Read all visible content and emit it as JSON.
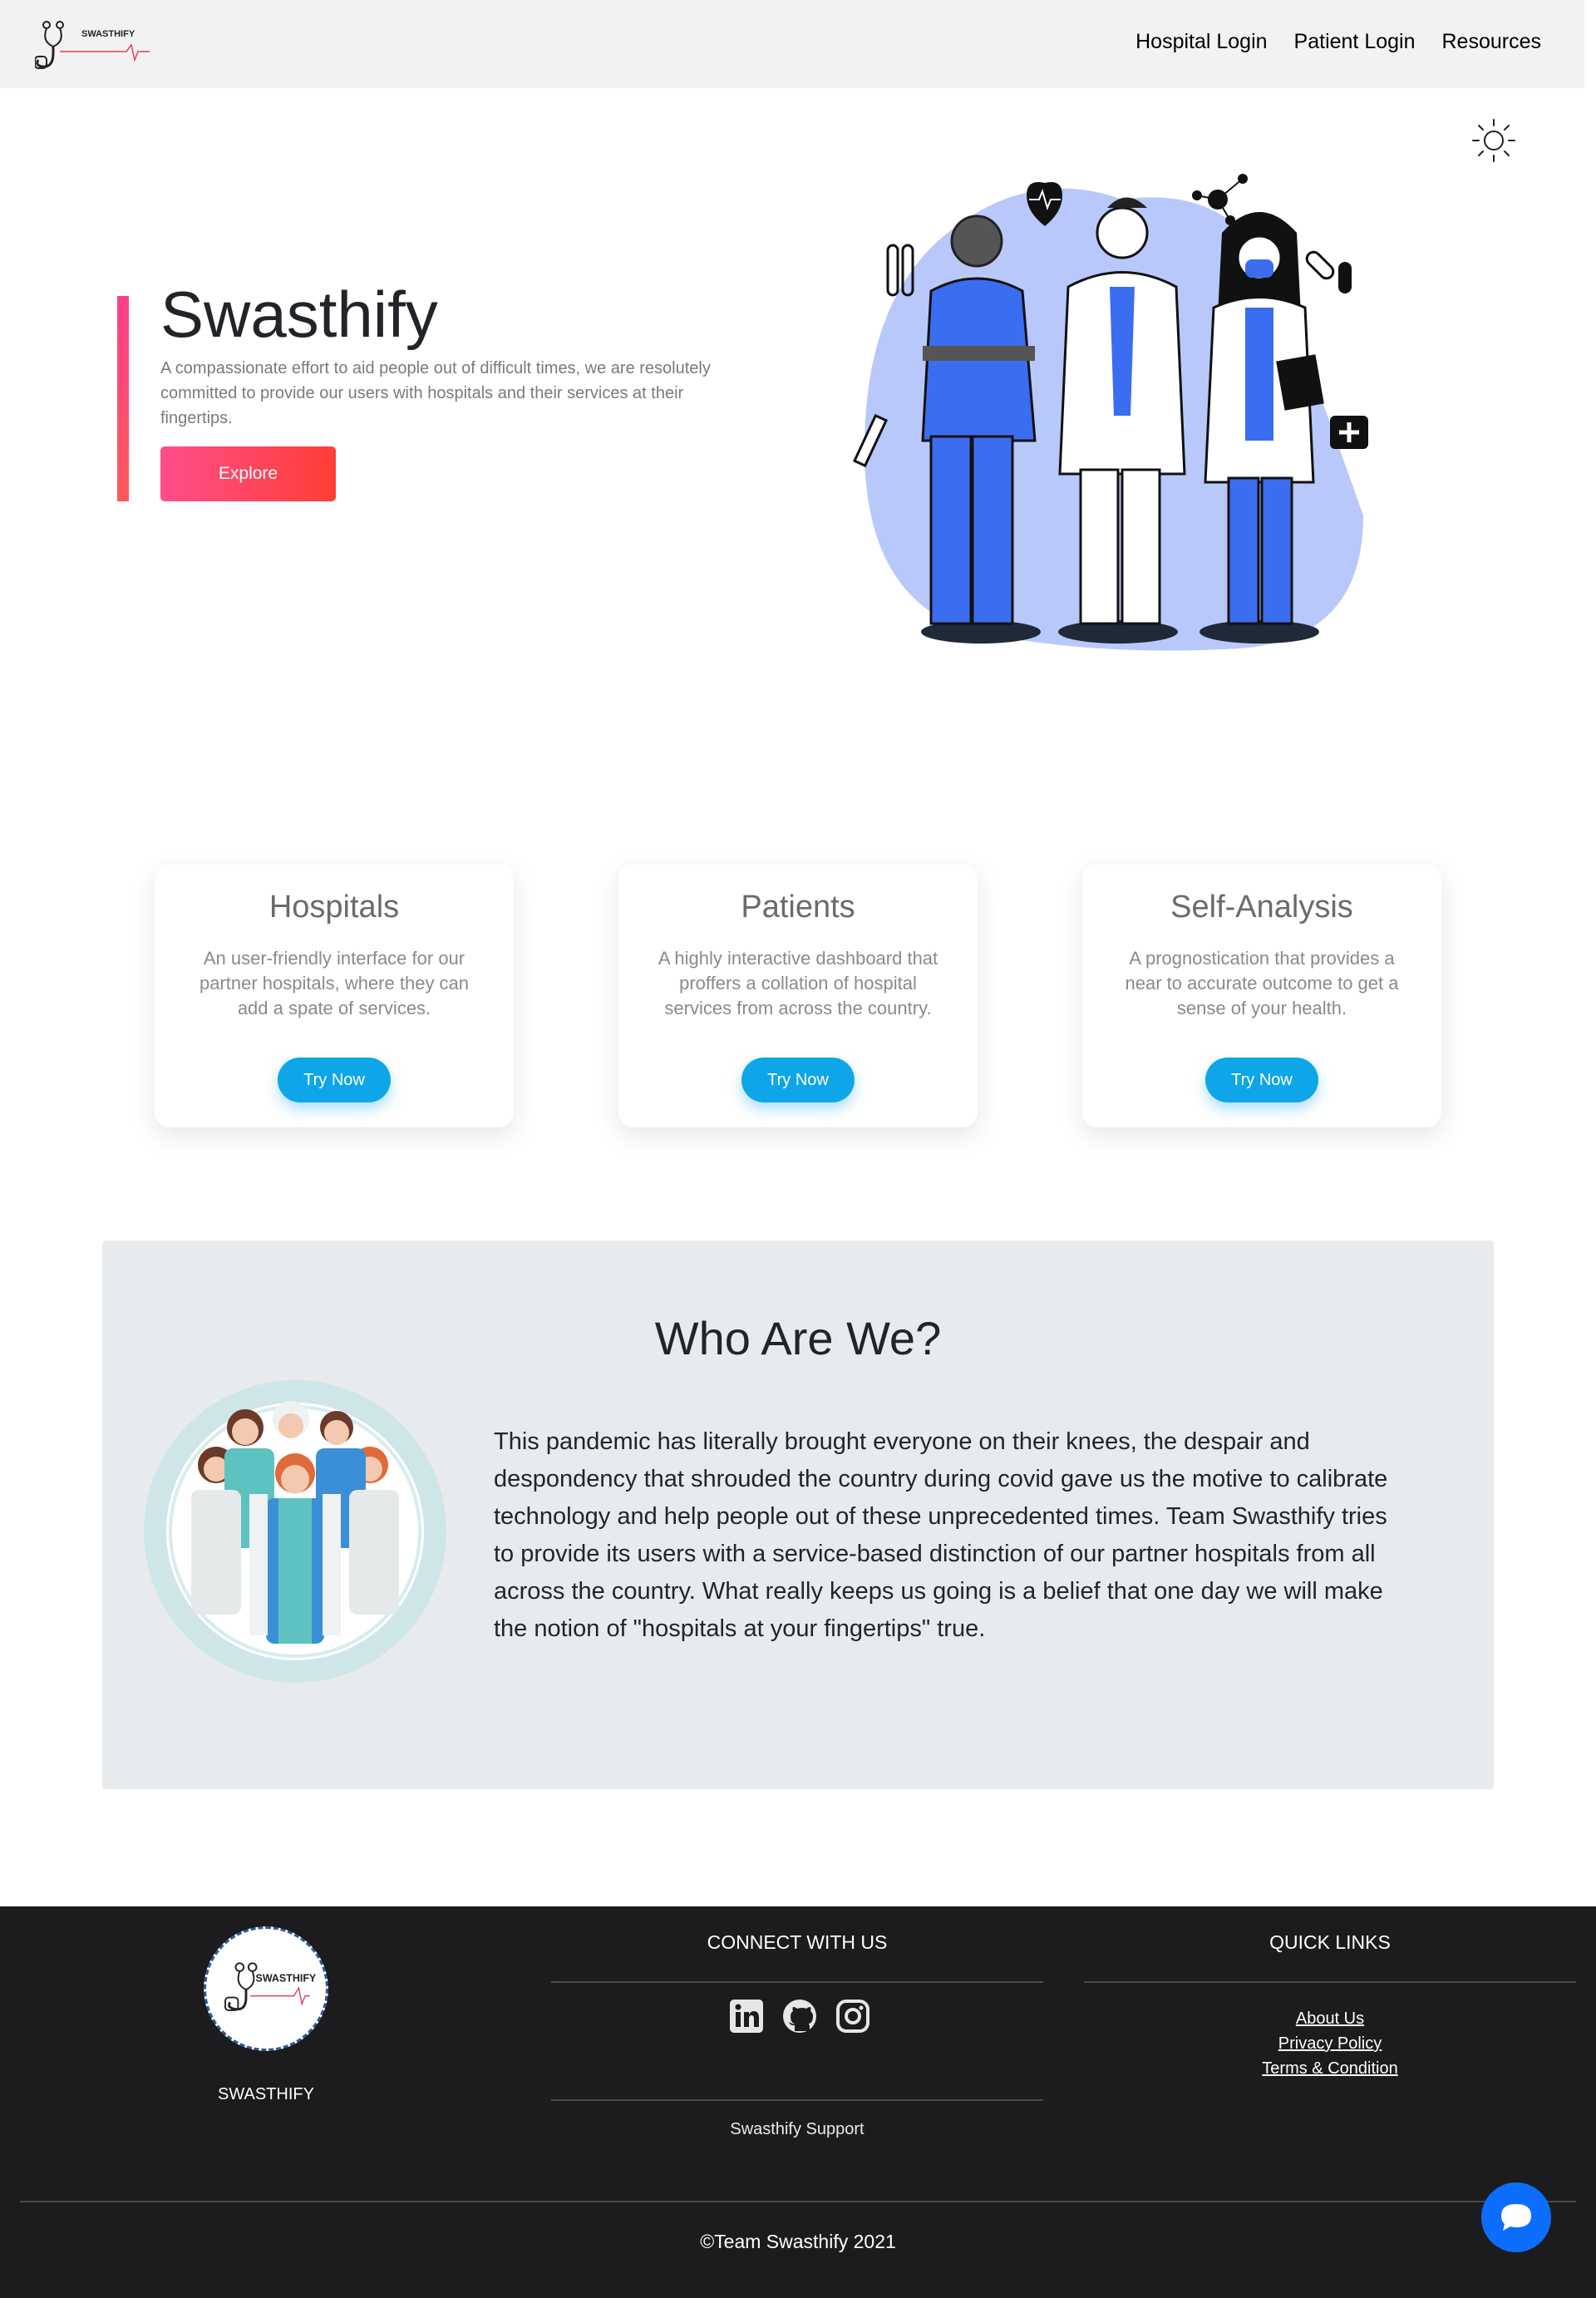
{
  "nav": {
    "logo_text": "SWASTHIFY",
    "links": [
      "Hospital Login",
      "Patient Login",
      "Resources"
    ]
  },
  "hero": {
    "title": "Swasthify",
    "description": "A compassionate effort to aid people out of difficult times, we are resolutely committed to provide our users with hospitals and their services at their fingertips.",
    "button": "Explore"
  },
  "cards": [
    {
      "title": "Hospitals",
      "text": "An user-friendly interface for our partner hospitals, where they can add a spate of services.",
      "button": "Try Now"
    },
    {
      "title": "Patients",
      "text": "A highly interactive dashboard that proffers a collation of hospital services from across the country.",
      "button": "Try Now"
    },
    {
      "title": "Self-Analysis",
      "text": "A prognostication that provides a near to accurate outcome to get a sense of your health.",
      "button": "Try Now"
    }
  ],
  "who": {
    "title": "Who Are We?",
    "text": "This pandemic has literally brought everyone on their knees, the despair and despondency that shrouded the country during covid gave us the motive to calibrate technology and help people out of these unprecedented times. Team Swasthify tries to provide its users with a service-based distinction of our partner hospitals from all across the country. What really keeps us going is a belief that one day we will make the notion of \"hospitals at your fingertips\" true."
  },
  "footer": {
    "logo_text": "SWASTHIFY",
    "brand": "SWASTHIFY",
    "connect_title": "CONNECT WITH US",
    "social_icons": [
      "linkedin-icon",
      "github-icon",
      "instagram-icon"
    ],
    "support": "Swasthify Support",
    "quick_title": "QUICK LINKS",
    "quick_links": [
      "About Us",
      "Privacy Policy",
      "Terms & Condition"
    ],
    "copyright": "©Team Swasthify 2021"
  },
  "colors": {
    "accent_pink": "#ff4d8b",
    "accent_red": "#ff3e35",
    "try_blue": "#0ea5e9",
    "chat_blue": "#0d6efd",
    "footer_bg": "#1c1c1e"
  }
}
